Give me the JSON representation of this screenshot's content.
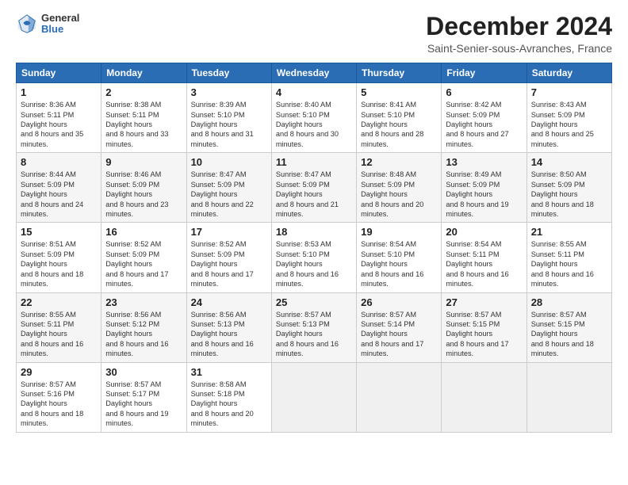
{
  "logo": {
    "general": "General",
    "blue": "Blue"
  },
  "header": {
    "month": "December 2024",
    "location": "Saint-Senier-sous-Avranches, France"
  },
  "weekdays": [
    "Sunday",
    "Monday",
    "Tuesday",
    "Wednesday",
    "Thursday",
    "Friday",
    "Saturday"
  ],
  "weeks": [
    [
      {
        "day": "1",
        "sunrise": "8:36 AM",
        "sunset": "5:11 PM",
        "daylight": "8 hours and 35 minutes."
      },
      {
        "day": "2",
        "sunrise": "8:38 AM",
        "sunset": "5:11 PM",
        "daylight": "8 hours and 33 minutes."
      },
      {
        "day": "3",
        "sunrise": "8:39 AM",
        "sunset": "5:10 PM",
        "daylight": "8 hours and 31 minutes."
      },
      {
        "day": "4",
        "sunrise": "8:40 AM",
        "sunset": "5:10 PM",
        "daylight": "8 hours and 30 minutes."
      },
      {
        "day": "5",
        "sunrise": "8:41 AM",
        "sunset": "5:10 PM",
        "daylight": "8 hours and 28 minutes."
      },
      {
        "day": "6",
        "sunrise": "8:42 AM",
        "sunset": "5:09 PM",
        "daylight": "8 hours and 27 minutes."
      },
      {
        "day": "7",
        "sunrise": "8:43 AM",
        "sunset": "5:09 PM",
        "daylight": "8 hours and 25 minutes."
      }
    ],
    [
      {
        "day": "8",
        "sunrise": "8:44 AM",
        "sunset": "5:09 PM",
        "daylight": "8 hours and 24 minutes."
      },
      {
        "day": "9",
        "sunrise": "8:46 AM",
        "sunset": "5:09 PM",
        "daylight": "8 hours and 23 minutes."
      },
      {
        "day": "10",
        "sunrise": "8:47 AM",
        "sunset": "5:09 PM",
        "daylight": "8 hours and 22 minutes."
      },
      {
        "day": "11",
        "sunrise": "8:47 AM",
        "sunset": "5:09 PM",
        "daylight": "8 hours and 21 minutes."
      },
      {
        "day": "12",
        "sunrise": "8:48 AM",
        "sunset": "5:09 PM",
        "daylight": "8 hours and 20 minutes."
      },
      {
        "day": "13",
        "sunrise": "8:49 AM",
        "sunset": "5:09 PM",
        "daylight": "8 hours and 19 minutes."
      },
      {
        "day": "14",
        "sunrise": "8:50 AM",
        "sunset": "5:09 PM",
        "daylight": "8 hours and 18 minutes."
      }
    ],
    [
      {
        "day": "15",
        "sunrise": "8:51 AM",
        "sunset": "5:09 PM",
        "daylight": "8 hours and 18 minutes."
      },
      {
        "day": "16",
        "sunrise": "8:52 AM",
        "sunset": "5:09 PM",
        "daylight": "8 hours and 17 minutes."
      },
      {
        "day": "17",
        "sunrise": "8:52 AM",
        "sunset": "5:09 PM",
        "daylight": "8 hours and 17 minutes."
      },
      {
        "day": "18",
        "sunrise": "8:53 AM",
        "sunset": "5:10 PM",
        "daylight": "8 hours and 16 minutes."
      },
      {
        "day": "19",
        "sunrise": "8:54 AM",
        "sunset": "5:10 PM",
        "daylight": "8 hours and 16 minutes."
      },
      {
        "day": "20",
        "sunrise": "8:54 AM",
        "sunset": "5:11 PM",
        "daylight": "8 hours and 16 minutes."
      },
      {
        "day": "21",
        "sunrise": "8:55 AM",
        "sunset": "5:11 PM",
        "daylight": "8 hours and 16 minutes."
      }
    ],
    [
      {
        "day": "22",
        "sunrise": "8:55 AM",
        "sunset": "5:11 PM",
        "daylight": "8 hours and 16 minutes."
      },
      {
        "day": "23",
        "sunrise": "8:56 AM",
        "sunset": "5:12 PM",
        "daylight": "8 hours and 16 minutes."
      },
      {
        "day": "24",
        "sunrise": "8:56 AM",
        "sunset": "5:13 PM",
        "daylight": "8 hours and 16 minutes."
      },
      {
        "day": "25",
        "sunrise": "8:57 AM",
        "sunset": "5:13 PM",
        "daylight": "8 hours and 16 minutes."
      },
      {
        "day": "26",
        "sunrise": "8:57 AM",
        "sunset": "5:14 PM",
        "daylight": "8 hours and 17 minutes."
      },
      {
        "day": "27",
        "sunrise": "8:57 AM",
        "sunset": "5:15 PM",
        "daylight": "8 hours and 17 minutes."
      },
      {
        "day": "28",
        "sunrise": "8:57 AM",
        "sunset": "5:15 PM",
        "daylight": "8 hours and 18 minutes."
      }
    ],
    [
      {
        "day": "29",
        "sunrise": "8:57 AM",
        "sunset": "5:16 PM",
        "daylight": "8 hours and 18 minutes."
      },
      {
        "day": "30",
        "sunrise": "8:57 AM",
        "sunset": "5:17 PM",
        "daylight": "8 hours and 19 minutes."
      },
      {
        "day": "31",
        "sunrise": "8:58 AM",
        "sunset": "5:18 PM",
        "daylight": "8 hours and 20 minutes."
      },
      null,
      null,
      null,
      null
    ]
  ]
}
